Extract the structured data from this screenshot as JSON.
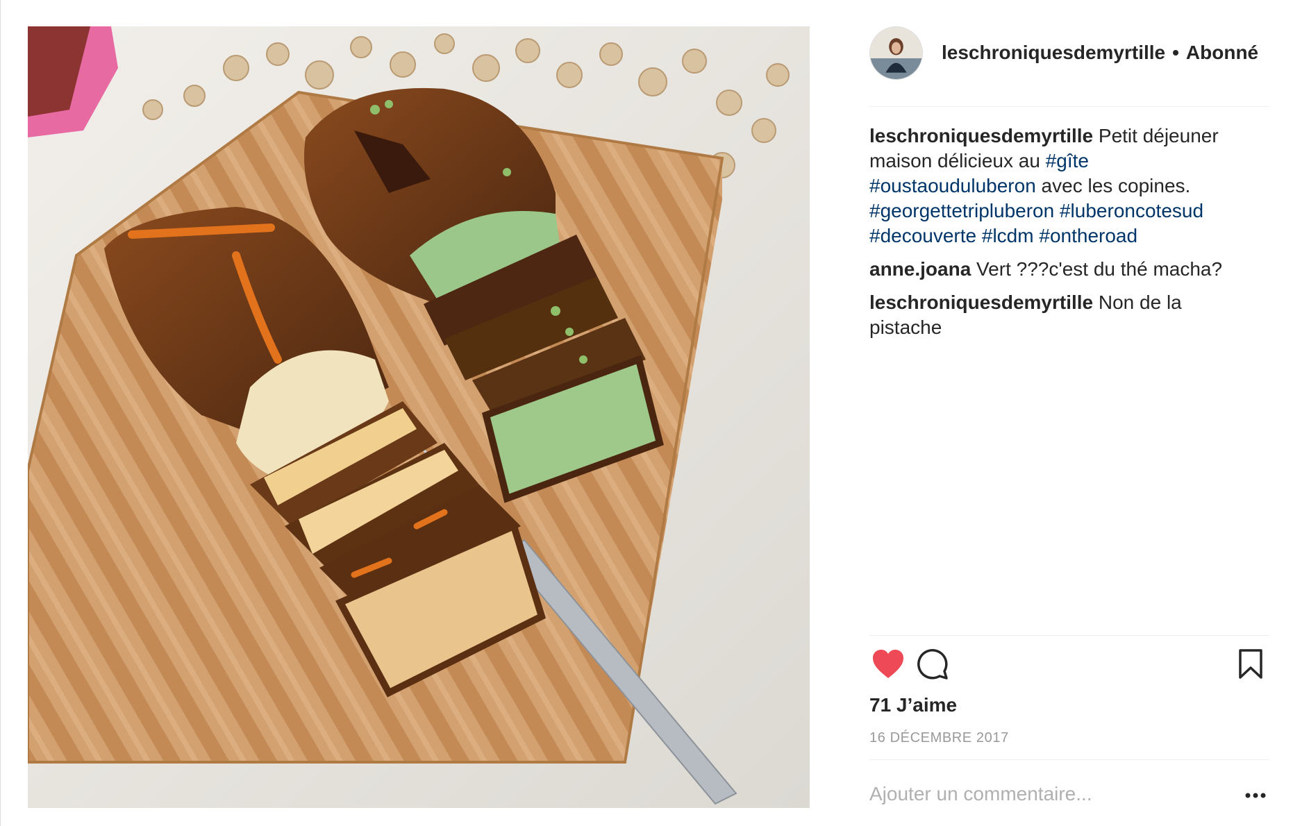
{
  "post": {
    "author": "leschroniquesdemyrtille",
    "follow_status": "Abonné",
    "likes_text": "71 J’aime",
    "date": "16 DÉCEMBRE 2017",
    "add_comment_placeholder": "Ajouter un commentaire...",
    "liked": true
  },
  "caption": {
    "user": "leschroniquesdemyrtille",
    "text_1": " Petit déjeuner maison délicieux au ",
    "tag_1": "#gîte",
    "sep_1": " ",
    "tag_2": "#oustaouduluberon",
    "text_2": " avec les copines. ",
    "tag_3": "#georgettetripluberon",
    "sep_2": " ",
    "tag_4": "#luberoncotesud",
    "sep_3": " ",
    "tag_5": "#decouverte",
    "sep_4": " ",
    "tag_6": "#lcdm",
    "sep_5": " ",
    "tag_7": "#ontheroad"
  },
  "comments": [
    {
      "user": "anne.joana",
      "text": " Vert ???c'est du thé macha?"
    },
    {
      "user": "leschroniquesdemyrtille",
      "text": " Non de la pistache"
    }
  ],
  "icons": {
    "like": "heart-icon",
    "comment": "comment-icon",
    "save": "bookmark-icon",
    "options": "more-options-icon"
  },
  "colors": {
    "heart": "#ed4956",
    "hashtag": "#003569",
    "username": "#262626",
    "meta": "#999999"
  }
}
